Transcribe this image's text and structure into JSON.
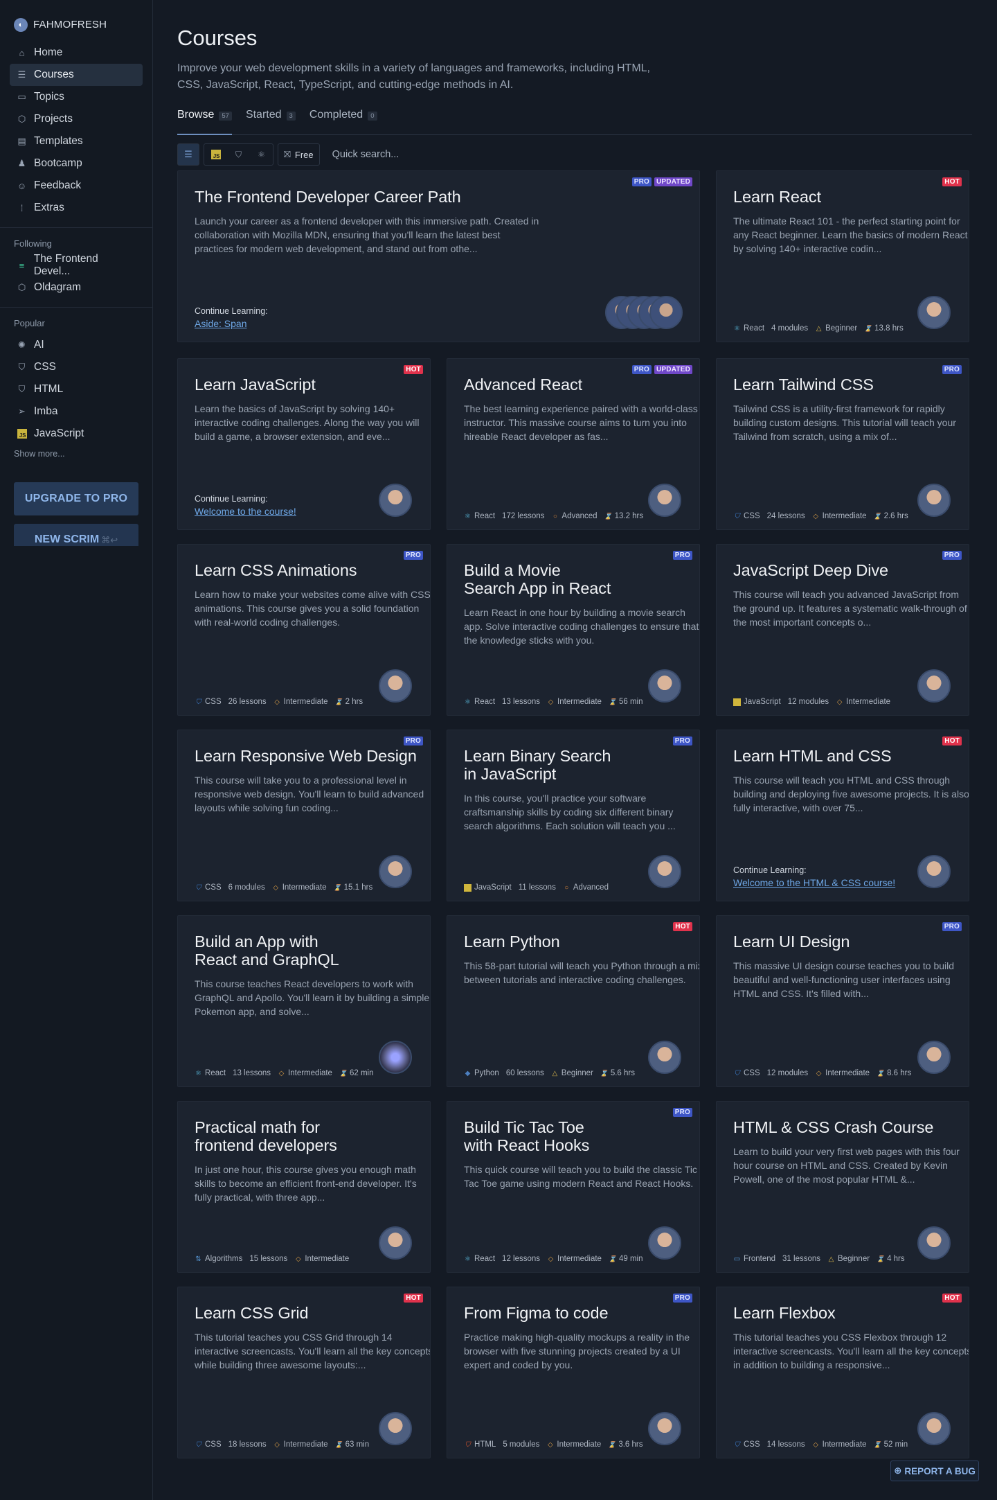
{
  "brand": {
    "name": "FAHMOFRESH",
    "logo_icon": "avatar-logo"
  },
  "sidebar": {
    "nav": [
      {
        "label": "Home",
        "icon": "home-icon"
      },
      {
        "label": "Courses",
        "icon": "courses-icon",
        "active": true
      },
      {
        "label": "Topics",
        "icon": "topics-icon"
      },
      {
        "label": "Projects",
        "icon": "projects-icon"
      },
      {
        "label": "Templates",
        "icon": "templates-icon"
      },
      {
        "label": "Bootcamp",
        "icon": "bootcamp-icon"
      },
      {
        "label": "Feedback",
        "icon": "feedback-icon"
      },
      {
        "label": "Extras",
        "icon": "extras-icon"
      }
    ],
    "following_title": "Following",
    "following": [
      {
        "label": "The Frontend Devel...",
        "icon": "path-icon"
      },
      {
        "label": "Oldagram",
        "icon": "project-icon"
      }
    ],
    "popular_title": "Popular",
    "popular": [
      {
        "label": "AI",
        "icon": "ai-icon"
      },
      {
        "label": "CSS",
        "icon": "css-icon"
      },
      {
        "label": "HTML",
        "icon": "html-icon"
      },
      {
        "label": "Imba",
        "icon": "imba-icon"
      },
      {
        "label": "JavaScript",
        "icon": "js-icon"
      }
    ],
    "show_more": "Show more...",
    "upgrade": "UPGRADE TO PRO",
    "new_scrim": "NEW SCRIM",
    "new_scrim_kbd": "⌘↩"
  },
  "header": {
    "title": "Courses",
    "subtitle": "Improve your web development skills in a variety of languages and frameworks, including HTML, CSS, JavaScript, React, TypeScript, and cutting-edge methods in AI."
  },
  "tabs": [
    {
      "label": "Browse",
      "count": "57",
      "active": true
    },
    {
      "label": "Started",
      "count": "3"
    },
    {
      "label": "Completed",
      "count": "0"
    }
  ],
  "filters": {
    "free_label": "Free",
    "search_placeholder": "Quick search..."
  },
  "colors": {
    "bg": "#141a24",
    "card": "#1c232f",
    "accent": "#6ea7e6",
    "pro": "#3e56c6",
    "updated": "#7048c9",
    "hot": "#e0324c"
  },
  "cards": [
    {
      "title": "The Frontend Developer Career Path",
      "desc": "Launch your career as a frontend developer with this immersive path. Created in collaboration with Mozilla MDN, ensuring that you'll learn the latest best practices for modern web development, and stand out from othe...",
      "badges": [
        "PRO",
        "UPDATED"
      ],
      "continue_label": "Continue Learning:",
      "continue_link": "Aside: Span",
      "avatars": 5
    },
    {
      "title": "Learn React",
      "desc": "The ultimate React 101 - the perfect starting point for any React beginner. Learn the basics of modern React by solving 140+ interactive codin...",
      "badges": [
        "HOT"
      ],
      "tech": "React",
      "tech_icon": "react",
      "count": "4 modules",
      "level": "Beginner",
      "duration": "13.8 hrs"
    },
    {
      "title": "Learn JavaScript",
      "desc": "Learn the basics of JavaScript by solving 140+ interactive coding challenges. Along the way you will build a game, a browser extension, and eve...",
      "badges": [
        "HOT"
      ],
      "continue_label": "Continue Learning:",
      "continue_link": "Welcome to the course!"
    },
    {
      "title": "Advanced React",
      "desc": "The best learning experience paired with a world-class instructor. This massive course aims to turn you into hireable React developer as fas...",
      "badges": [
        "PRO",
        "UPDATED"
      ],
      "tech": "React",
      "tech_icon": "react",
      "count": "172 lessons",
      "level": "Advanced",
      "duration": "13.2 hrs"
    },
    {
      "title": "Learn Tailwind CSS",
      "desc": "Tailwind CSS is a utility-first framework for rapidly building custom designs. This tutorial will teach your Tailwind from scratch, using a mix of...",
      "badges": [
        "PRO"
      ],
      "tech": "CSS",
      "tech_icon": "css",
      "count": "24 lessons",
      "level": "Intermediate",
      "duration": "2.6 hrs"
    },
    {
      "title": "Learn CSS Animations",
      "desc": "Learn how to make your websites come alive with CSS animations. This course gives you a solid foundation with real-world coding challenges.",
      "badges": [
        "PRO"
      ],
      "tech": "CSS",
      "tech_icon": "css",
      "count": "26 lessons",
      "level": "Intermediate",
      "duration": "2 hrs"
    },
    {
      "title": "Build a Movie\nSearch App in React",
      "desc": "Learn React in one hour by building a movie search app. Solve interactive coding challenges to ensure that the knowledge sticks with you.",
      "badges": [
        "PRO"
      ],
      "tech": "React",
      "tech_icon": "react",
      "count": "13 lessons",
      "level": "Intermediate",
      "duration": "56 min"
    },
    {
      "title": "JavaScript Deep Dive",
      "desc": "This course will teach you advanced JavaScript from the ground up. It features a systematic walk-through of the most important concepts o...",
      "badges": [
        "PRO"
      ],
      "tech": "JavaScript",
      "tech_icon": "js",
      "count": "12 modules",
      "level": "Intermediate",
      "duration": ""
    },
    {
      "title": "Learn Responsive Web Design",
      "desc": "This course will take you to a professional level in responsive web design. You'll learn to build advanced layouts while solving fun coding...",
      "badges": [
        "PRO"
      ],
      "tech": "CSS",
      "tech_icon": "css",
      "count": "6 modules",
      "level": "Intermediate",
      "duration": "15.1 hrs"
    },
    {
      "title": "Learn Binary Search\nin JavaScript",
      "desc": "In this course, you'll practice your software craftsmanship skills by coding six different binary search algorithms. Each solution will teach you ...",
      "badges": [
        "PRO"
      ],
      "tech": "JavaScript",
      "tech_icon": "js",
      "count": "11 lessons",
      "level": "Advanced",
      "duration": ""
    },
    {
      "title": "Learn HTML and CSS",
      "desc": "This course will teach you HTML and CSS through building and deploying five awesome projects. It is also fully interactive, with over 75...",
      "badges": [
        "HOT"
      ],
      "continue_label": "Continue Learning:",
      "continue_link": "Welcome to the HTML & CSS course!"
    },
    {
      "title": "Build an App with\nReact and GraphQL",
      "desc": "This course teaches React developers to work with GraphQL and Apollo. You'll learn it by building a simple Pokemon app, and solve...",
      "badges": [],
      "tech": "React",
      "tech_icon": "react",
      "count": "13 lessons",
      "level": "Intermediate",
      "duration": "62 min",
      "avatar_style": "tool"
    },
    {
      "title": "Learn Python",
      "desc": "This 58-part tutorial will teach you Python through a mix between tutorials and interactive coding challenges.",
      "badges": [
        "HOT"
      ],
      "tech": "Python",
      "tech_icon": "py",
      "count": "60 lessons",
      "level": "Beginner",
      "duration": "5.6 hrs"
    },
    {
      "title": "Learn UI Design",
      "desc": "This massive UI design course teaches you to build beautiful and well-functioning user interfaces using HTML and CSS. It's filled with...",
      "badges": [
        "PRO"
      ],
      "tech": "CSS",
      "tech_icon": "css",
      "count": "12 modules",
      "level": "Intermediate",
      "duration": "8.6 hrs"
    },
    {
      "title": "Practical math for\nfrontend developers",
      "desc": "In just one hour, this course gives you enough math skills to become an efficient front-end developer. It's fully practical, with three app...",
      "badges": [],
      "tech": "Algorithms",
      "tech_icon": "alg",
      "count": "15 lessons",
      "level": "Intermediate",
      "duration": ""
    },
    {
      "title": "Build Tic Tac Toe\nwith React Hooks",
      "desc": "This quick course will teach you to build the classic Tic Tac Toe game using modern React and React Hooks.",
      "badges": [
        "PRO"
      ],
      "tech": "React",
      "tech_icon": "react",
      "count": "12 lessons",
      "level": "Intermediate",
      "duration": "49 min"
    },
    {
      "title": "HTML & CSS Crash Course",
      "desc": "Learn to build your very first web pages with this four hour course on HTML and CSS. Created by Kevin Powell, one of the most popular HTML &...",
      "badges": [],
      "tech": "Frontend",
      "tech_icon": "fe",
      "count": "31 lessons",
      "level": "Beginner",
      "duration": "4 hrs"
    },
    {
      "title": "Learn CSS Grid",
      "desc": "This tutorial teaches you CSS Grid through 14 interactive screencasts. You'll learn all the key concepts while building three awesome layouts:...",
      "badges": [
        "HOT"
      ],
      "tech": "CSS",
      "tech_icon": "css",
      "count": "18 lessons",
      "level": "Intermediate",
      "duration": "63 min"
    },
    {
      "title": "From Figma to code",
      "desc": "Practice making high-quality mockups a reality in the browser with five stunning projects created by a UI expert and coded by you.",
      "badges": [
        "PRO"
      ],
      "tech": "HTML",
      "tech_icon": "html",
      "count": "5 modules",
      "level": "Intermediate",
      "duration": "3.6 hrs"
    },
    {
      "title": "Learn Flexbox",
      "desc": "This tutorial teaches you CSS Flexbox through 12 interactive screencasts. You'll learn all the key concepts in addition to building a responsive...",
      "badges": [
        "HOT"
      ],
      "tech": "CSS",
      "tech_icon": "css",
      "count": "14 lessons",
      "level": "Intermediate",
      "duration": "52 min"
    }
  ],
  "report_bug": "REPORT A BUG"
}
